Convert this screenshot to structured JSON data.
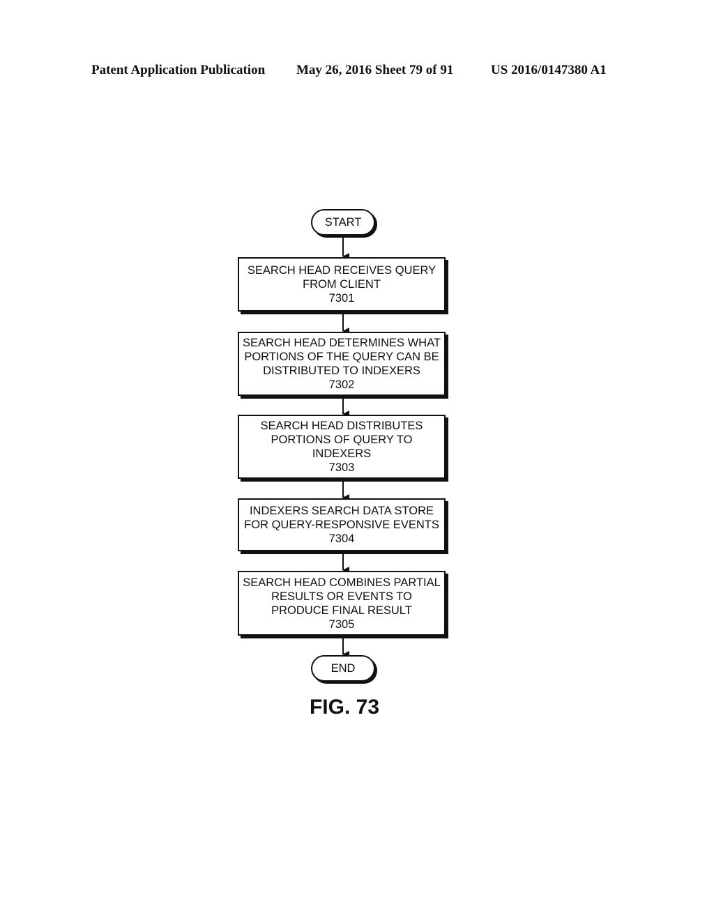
{
  "header": {
    "publication": "Patent Application Publication",
    "date_sheet": "May 26, 2016  Sheet 79 of 91",
    "patent_number": "US 2016/0147380 A1"
  },
  "flowchart": {
    "start_label": "START",
    "end_label": "END",
    "steps": [
      {
        "lines": [
          "SEARCH HEAD RECEIVES QUERY",
          "FROM CLIENT"
        ],
        "ref": "7301"
      },
      {
        "lines": [
          "SEARCH HEAD DETERMINES WHAT",
          "PORTIONS OF THE QUERY CAN BE",
          "DISTRIBUTED TO INDEXERS"
        ],
        "ref": "7302"
      },
      {
        "lines": [
          "SEARCH HEAD DISTRIBUTES",
          "PORTIONS OF QUERY TO",
          "INDEXERS"
        ],
        "ref": "7303"
      },
      {
        "lines": [
          "INDEXERS SEARCH DATA STORE",
          "FOR QUERY-RESPONSIVE EVENTS"
        ],
        "ref": "7304"
      },
      {
        "lines": [
          "SEARCH HEAD COMBINES PARTIAL",
          "RESULTS OR EVENTS TO",
          "PRODUCE FINAL RESULT"
        ],
        "ref": "7305"
      }
    ],
    "figure_label": "FIG. 73"
  }
}
